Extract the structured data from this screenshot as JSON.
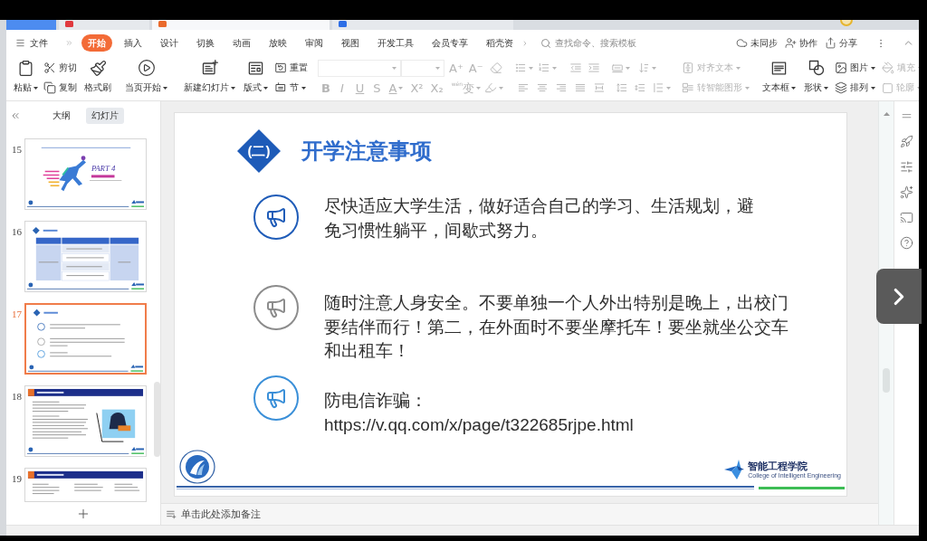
{
  "tab_bar": {
    "tabs": [
      {
        "kind": "home",
        "selected": false
      },
      {
        "kind": "wps",
        "selected": false
      },
      {
        "kind": "presentation",
        "selected": true
      },
      {
        "kind": "document",
        "selected": false
      }
    ]
  },
  "menu_bar": {
    "file": "文件",
    "tabs": [
      {
        "label": "开始",
        "selected": true
      },
      {
        "label": "插入",
        "selected": false
      },
      {
        "label": "设计",
        "selected": false
      },
      {
        "label": "切换",
        "selected": false
      },
      {
        "label": "动画",
        "selected": false
      },
      {
        "label": "放映",
        "selected": false
      },
      {
        "label": "审阅",
        "selected": false
      },
      {
        "label": "视图",
        "selected": false
      },
      {
        "label": "开发工具",
        "selected": false
      },
      {
        "label": "会员专享",
        "selected": false
      },
      {
        "label": "稻壳资",
        "selected": false
      }
    ],
    "search": {
      "placeholder": "查找命令、搜索模板"
    },
    "actions": [
      {
        "kind": "sync",
        "label": "未同步"
      },
      {
        "kind": "collaborate",
        "label": "协作"
      },
      {
        "kind": "share",
        "label": "分享"
      }
    ]
  },
  "ribbon": {
    "paste": {
      "label": "粘贴",
      "dropdown": true
    },
    "cut": {
      "label": "剪切"
    },
    "copy": {
      "label": "复制"
    },
    "format_painter": {
      "label": "格式刷"
    },
    "play_current": {
      "label": "当页开始",
      "dropdown": true
    },
    "new_slide": {
      "label": "新建幻灯片",
      "dropdown": true
    },
    "layout": {
      "label": "版式",
      "dropdown": true
    },
    "reset": {
      "label": "重置"
    },
    "section": {
      "label": "节",
      "dropdown": true
    },
    "font": {
      "disabled": true,
      "size_buttons": [
        "A⁺",
        "A⁻"
      ],
      "style_buttons": [
        {
          "label": "B"
        },
        {
          "label": "I"
        },
        {
          "label": "U"
        },
        {
          "label": "S"
        },
        {
          "label": "A",
          "dropdown": true
        },
        {
          "label": "X²"
        },
        {
          "label": "X₂"
        },
        {
          "label": "$^{wén}$变",
          "dropdown": true
        }
      ]
    },
    "paragraph": {
      "disabled": true
    },
    "align_text": {
      "label": "对齐文本",
      "dropdown": true,
      "disabled": true
    },
    "smart_graphic": {
      "label": "转智能图形",
      "dropdown": true,
      "disabled": true
    },
    "text_box": {
      "label": "文本框",
      "dropdown": true
    },
    "shape": {
      "label": "形状",
      "dropdown": true
    },
    "picture": {
      "label": "图片",
      "dropdown": true
    },
    "arrange": {
      "label": "排列",
      "dropdown": true
    },
    "fill": {
      "label": "填充",
      "dropdown": true,
      "disabled": true
    },
    "outline": {
      "label": "轮廓",
      "dropdown": true,
      "disabled": true
    }
  },
  "slide_panel": {
    "tabs": [
      {
        "label": "大纲",
        "selected": false
      },
      {
        "label": "幻灯片",
        "selected": true
      }
    ],
    "thumbnails": [
      {
        "number": "15",
        "kind": "section",
        "selected": false,
        "text": "PART 4"
      },
      {
        "number": "16",
        "kind": "table",
        "selected": false
      },
      {
        "number": "17",
        "kind": "list",
        "selected": true
      },
      {
        "number": "18",
        "kind": "case",
        "selected": false
      },
      {
        "number": "19",
        "kind": "columns",
        "selected": false
      }
    ]
  },
  "slide": {
    "badge": "(二)",
    "title": "开学注意事项",
    "items": [
      {
        "text": "尽快适应大学生活，做好适合自己的学习、生活规划，避免习惯性躺平，间歇式努力。",
        "color": "#1f5cb8"
      },
      {
        "text": "随时注意人身安全。不要单独一个人外出特别是晚上，出校门要结伴而行！第二，在外面时不要坐摩托车！要坐就坐公交车和出租车！",
        "color": "#8c8c8c"
      },
      {
        "text": "防电信诈骗：",
        "link": "https://v.qq.com/x/page/t322685rjpe.html",
        "color": "#3a8fd8"
      }
    ],
    "college": {
      "name": "智能工程学院",
      "subtitle": "College of Intelligent Engineering"
    }
  },
  "notes": {
    "placeholder": "单击此处添加备注"
  }
}
